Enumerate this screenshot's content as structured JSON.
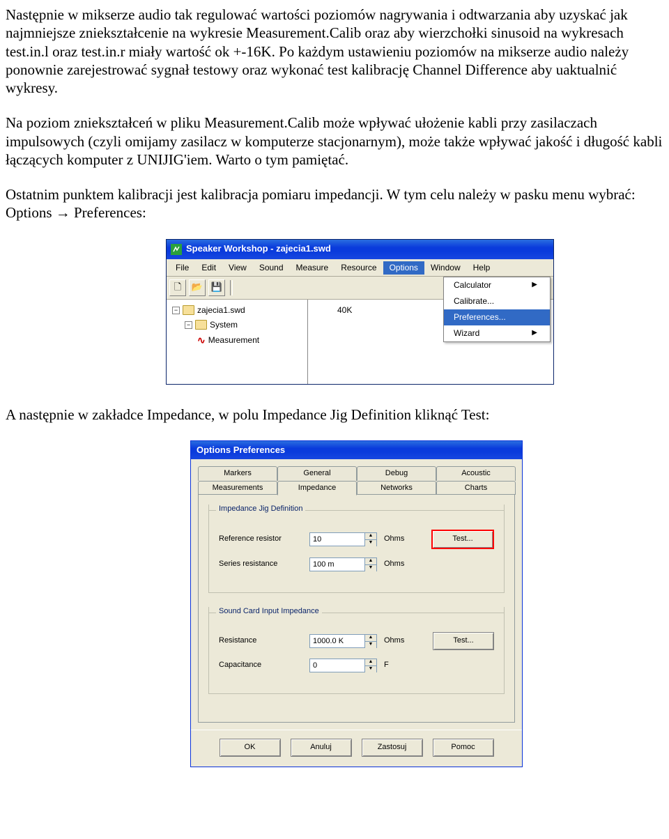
{
  "para1": "Następnie w mikserze audio tak regulować wartości poziomów nagrywania i odtwarzania aby uzyskać jak najmniejsze zniekształcenie na wykresie Measurement.Calib oraz aby wierzchołki sinusoid na wykresach test.in.l oraz test.in.r miały wartość ok +-16K. Po każdym ustawieniu poziomów na mikserze audio należy ponownie zarejestrować sygnał testowy oraz wykonać test kalibrację Channel Difference aby uaktualnić wykresy.",
  "para2": "Na poziom zniekształceń w pliku Measurement.Calib może wpływać ułożenie kabli przy zasilaczach impulsowych (czyli omijamy zasilacz w komputerze stacjonarnym), może także wpływać jakość i długość kabli łączących komputer z UNIJIG'iem. Warto o tym pamiętać.",
  "para3": "Ostatnim punktem kalibracji jest kalibracja pomiaru impedancji. W tym celu należy w pasku menu wybrać: Options → Preferences:",
  "para4": "A następnie w zakładce Impedance, w polu Impedance Jig Definition kliknąć Test:",
  "app": {
    "title": "Speaker Workshop - zajecia1.swd",
    "menu": {
      "file": "File",
      "edit": "Edit",
      "view": "View",
      "sound": "Sound",
      "measure": "Measure",
      "resource": "Resource",
      "options": "Options",
      "window": "Window",
      "help": "Help"
    },
    "options_menu": {
      "calculator": "Calculator",
      "calibrate": "Calibrate...",
      "preferences": "Preferences...",
      "wizard": "Wizard"
    },
    "tree": {
      "root": "zajecia1.swd",
      "system": "System",
      "measurement": "Measurement"
    },
    "chart": {
      "ytick": "40K"
    }
  },
  "prefs": {
    "title": "Options Preferences",
    "tabs": {
      "markers": "Markers",
      "general": "General",
      "debug": "Debug",
      "acoustic": "Acoustic",
      "measurements": "Measurements",
      "impedance": "Impedance",
      "networks": "Networks",
      "charts": "Charts"
    },
    "group1": {
      "legend": "Impedance Jig Definition",
      "ref_label": "Reference resistor",
      "ref_value": "10",
      "series_label": "Series resistance",
      "series_value": "100 m",
      "unit": "Ohms",
      "test": "Test..."
    },
    "group2": {
      "legend": "Sound Card Input Impedance",
      "res_label": "Resistance",
      "res_value": "1000.0 K",
      "res_unit": "Ohms",
      "cap_label": "Capacitance",
      "cap_value": "0",
      "cap_unit": "F",
      "test": "Test..."
    },
    "buttons": {
      "ok": "OK",
      "cancel": "Anuluj",
      "apply": "Zastosuj",
      "help": "Pomoc"
    }
  }
}
